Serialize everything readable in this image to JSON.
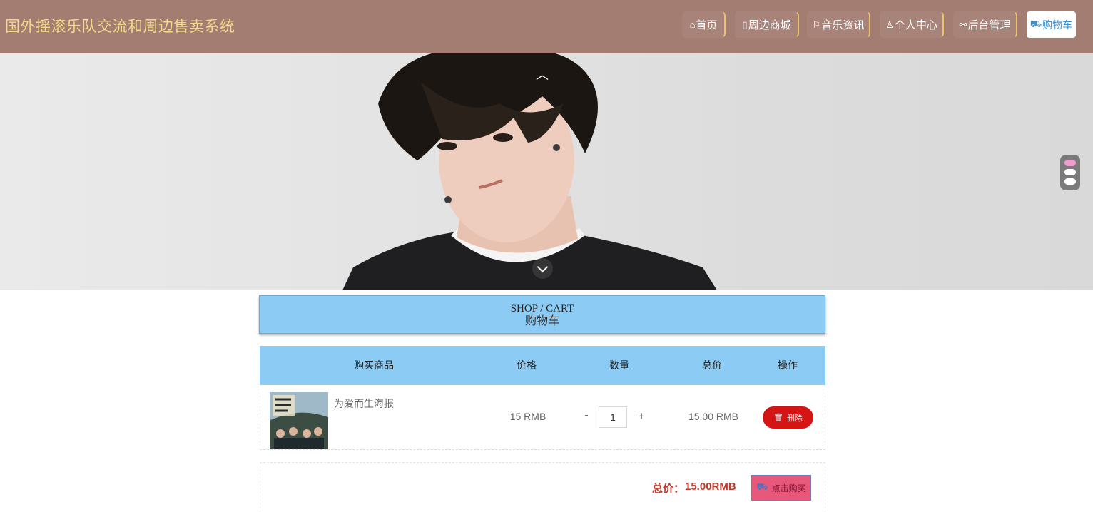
{
  "app": {
    "title": "国外摇滚乐队交流和周边售卖系统"
  },
  "nav": [
    {
      "icon": "home-icon",
      "glyph": "⌂",
      "label": "首页"
    },
    {
      "icon": "shop-icon",
      "glyph": "▯",
      "label": "周边商城"
    },
    {
      "icon": "flag-icon",
      "glyph": "⚐",
      "label": "音乐资讯"
    },
    {
      "icon": "user-icon",
      "glyph": "♙",
      "label": "个人中心"
    },
    {
      "icon": "link-icon",
      "glyph": "⚯",
      "label": "后台管理"
    },
    {
      "icon": "cart-icon",
      "glyph": "⛟",
      "label": "购物车",
      "active": true
    }
  ],
  "banner": {
    "active_slide": 1,
    "slide_count": 3
  },
  "section": {
    "title_en": "SHOP / CART",
    "title_zh": "购物车"
  },
  "cart": {
    "headers": [
      "购买商品",
      "价格",
      "数量",
      "总价",
      "操作"
    ],
    "items": [
      {
        "name": "为爱而生海报",
        "price": "15 RMB",
        "quantity": "1",
        "total": "15.00 RMB",
        "delete_label": "删除",
        "qty_minus": "-",
        "qty_plus": "+"
      }
    ]
  },
  "summary": {
    "total_label": "总价：",
    "total_value": "15.00RMB",
    "buy_label": "点击购买"
  },
  "colors": {
    "header_bg": "#a47d72",
    "brand_text": "#f1d98a",
    "table_header_bg": "#8ccbf4",
    "delete_button": "#d51414",
    "buy_button": "#e8587a",
    "total_text": "#c0392b"
  }
}
